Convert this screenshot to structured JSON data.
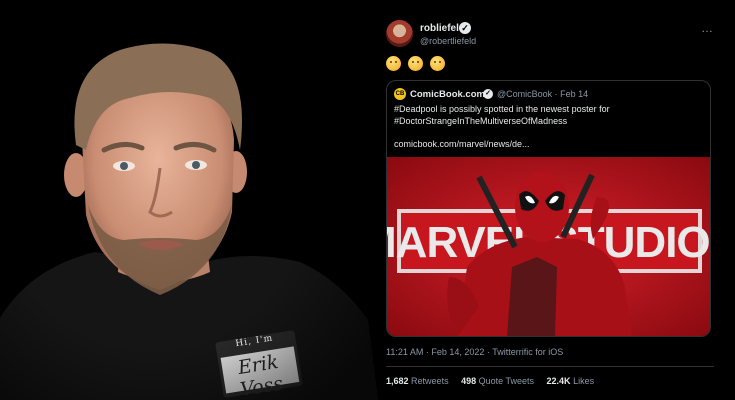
{
  "tweet": {
    "display_name": "robliefeld",
    "handle": "@robertliefeld",
    "more_icon": "…",
    "emojis": [
      "thinking-face-emoji",
      "shushing-face-emoji",
      "kissing-face-emoji"
    ],
    "quote": {
      "logo_text": "CB",
      "name": "ComicBook.com",
      "handle_date": "@ComicBook · Feb 14",
      "text_line1": "#Deadpool is possibly spotted in the newest poster for",
      "text_line2": "#DoctorStrangeInTheMultiverseOfMadness",
      "link": "comicbook.com/marvel/news/de...",
      "image_text": "MARVEL STUDIOS"
    },
    "timestamp": "11:21 AM · Feb 14, 2022 · Twitterrific for iOS",
    "stats": {
      "retweets_count": "1,682",
      "retweets_label": "Retweets",
      "quotes_count": "498",
      "quotes_label": "Quote Tweets",
      "likes_count": "22.4K",
      "likes_label": "Likes"
    }
  },
  "presenter": {
    "name_tag_hi": "Hi, I'm",
    "name_tag_name": "Erik Voss"
  },
  "colors": {
    "background": "#000000",
    "muted_text": "#8b98a5",
    "poster_red": "#c0141c",
    "deadpool_red": "#b3121a"
  }
}
